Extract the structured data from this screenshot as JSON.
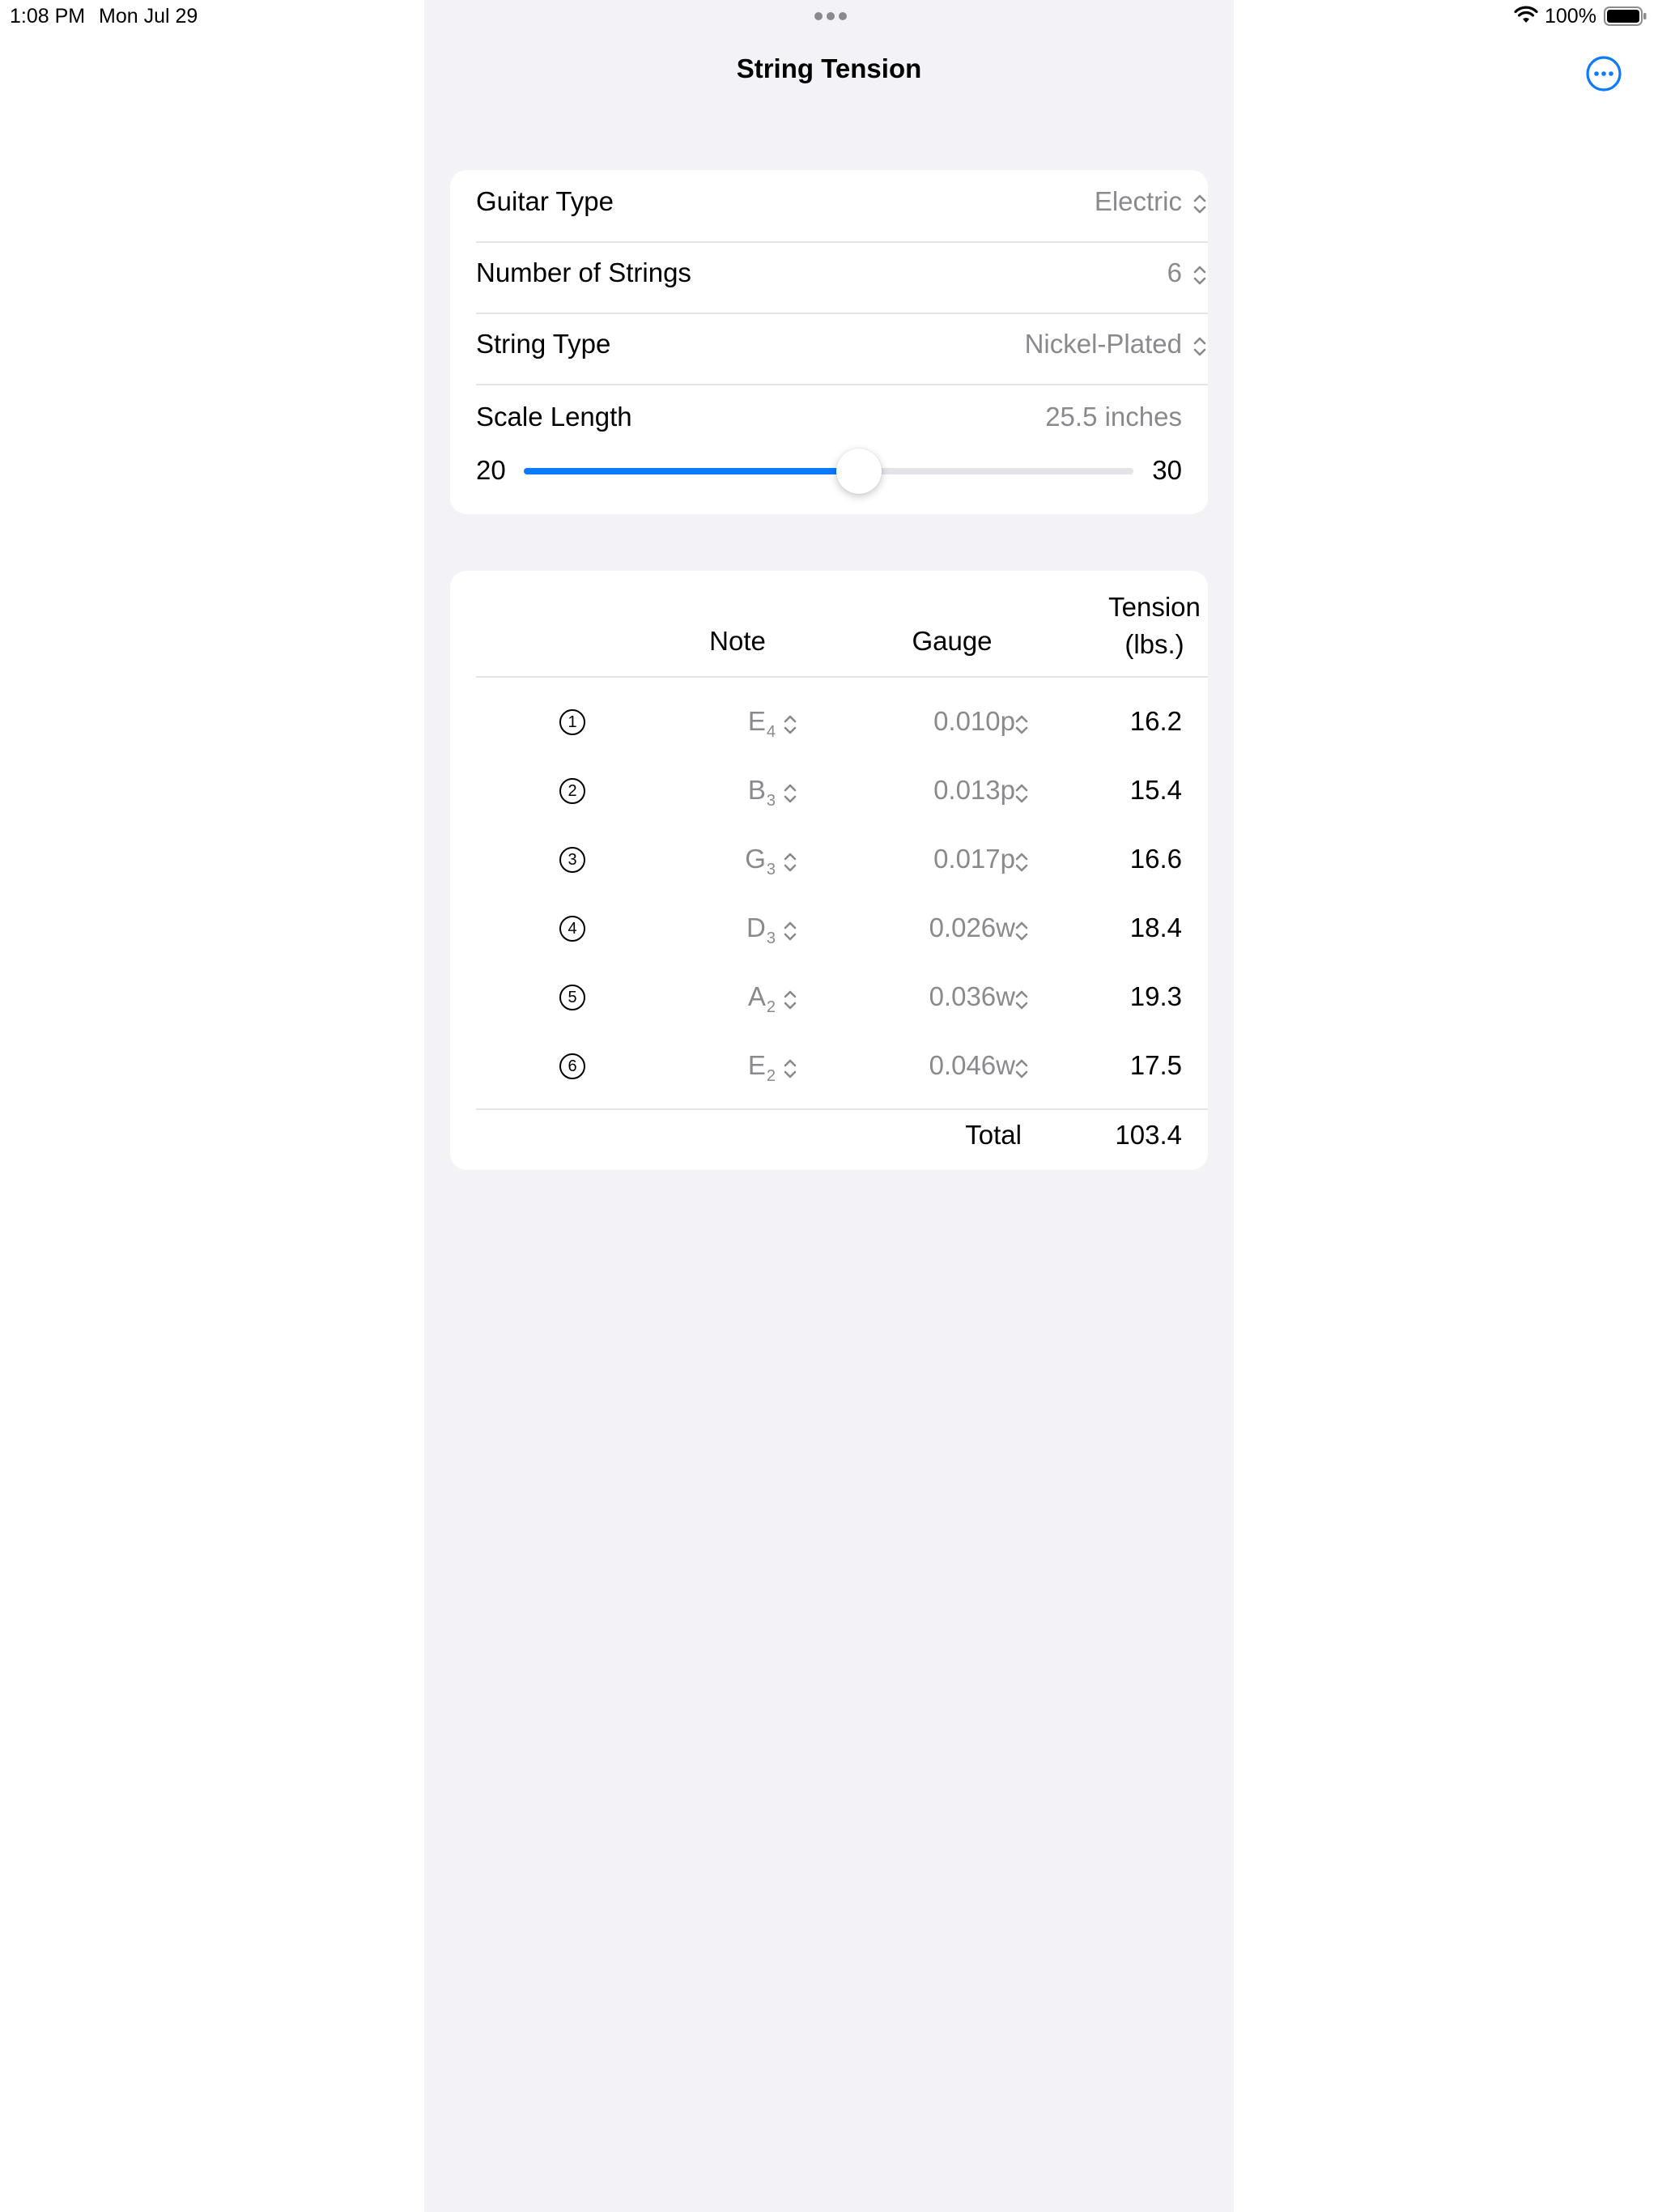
{
  "status_bar": {
    "time": "1:08 PM",
    "date": "Mon Jul 29",
    "battery": "100%"
  },
  "nav": {
    "title": "String Tension"
  },
  "settings": {
    "guitar_type": {
      "label": "Guitar Type",
      "value": "Electric"
    },
    "num_strings": {
      "label": "Number of Strings",
      "value": "6"
    },
    "string_type": {
      "label": "String Type",
      "value": "Nickel-Plated"
    },
    "scale_length": {
      "label": "Scale Length",
      "value": "25.5 inches",
      "min": "20",
      "max": "30",
      "current": 25.5,
      "range": [
        20,
        30
      ]
    }
  },
  "table": {
    "headers": {
      "note": "Note",
      "gauge": "Gauge",
      "tension_line1": "Tension",
      "tension_line2": "(lbs.)"
    },
    "rows": [
      {
        "num": "1",
        "note": "E",
        "octave": "4",
        "gauge": "0.010p",
        "tension": "16.2"
      },
      {
        "num": "2",
        "note": "B",
        "octave": "3",
        "gauge": "0.013p",
        "tension": "15.4"
      },
      {
        "num": "3",
        "note": "G",
        "octave": "3",
        "gauge": "0.017p",
        "tension": "16.6"
      },
      {
        "num": "4",
        "note": "D",
        "octave": "3",
        "gauge": "0.026w",
        "tension": "18.4"
      },
      {
        "num": "5",
        "note": "A",
        "octave": "2",
        "gauge": "0.036w",
        "tension": "19.3"
      },
      {
        "num": "6",
        "note": "E",
        "octave": "2",
        "gauge": "0.046w",
        "tension": "17.5"
      }
    ],
    "total_label": "Total",
    "total_value": "103.4"
  },
  "colors": {
    "accent": "#0a7aff",
    "secondary_text": "#8a8a8e",
    "panel_bg": "#f2f2f7"
  }
}
